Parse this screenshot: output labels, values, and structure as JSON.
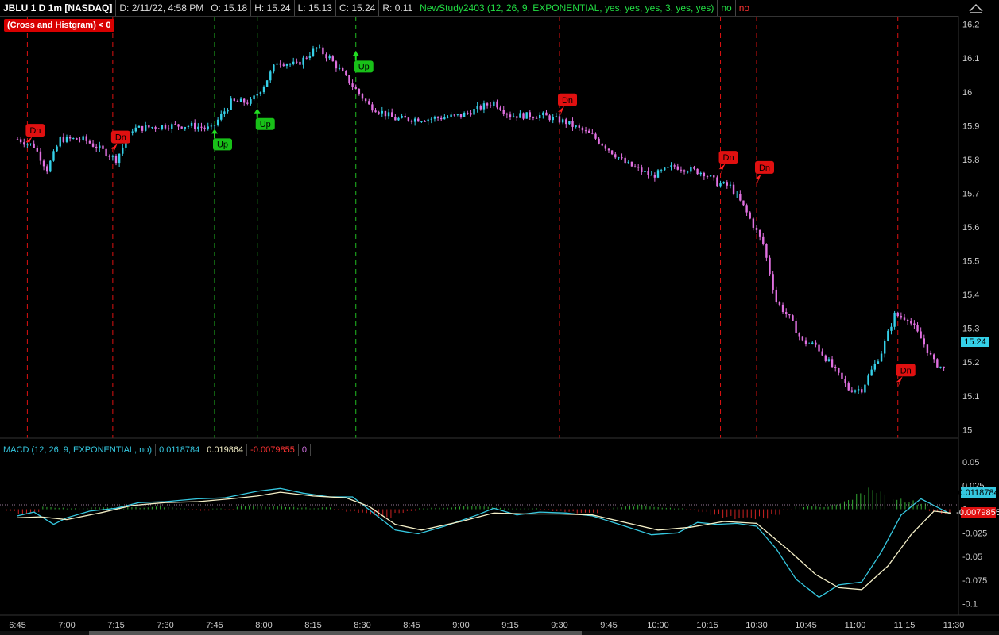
{
  "header": {
    "symbol": "JBLU 1 D 1m [NASDAQ]",
    "date": "D: 2/11/22, 4:58 PM",
    "open": "O: 15.18",
    "high": "H: 15.24",
    "low": "L: 15.13",
    "close": "C: 15.24",
    "range": "R: 0.11",
    "study": "NewStudy2403 (12, 26, 9, EXPONENTIAL, yes, yes, yes, 3, yes, yes)",
    "flag1": "no",
    "flag2": "no"
  },
  "alert_label": "(Cross and Histgram) < 0",
  "macd_header": {
    "label": "MACD (12, 26, 9, EXPONENTIAL, no)",
    "value": "0.0118784",
    "avg": "0.019864",
    "diff": "-0.0079855",
    "zero": "0"
  },
  "colors": {
    "up_candle": "#35d0e8",
    "down_candle": "#e070e0",
    "signal_up": "#22bb22",
    "signal_dn": "#dd1111",
    "macd_line": "#35c8e0",
    "avg_line": "#f5f0c8",
    "hist_pos": "#33aa33",
    "hist_neg": "#cc2222"
  },
  "chart_data": [
    {
      "type": "candlestick",
      "title": "JBLU 1 D 1m [NASDAQ]",
      "x_ticks": [
        "6:45",
        "7:00",
        "7:15",
        "7:30",
        "7:45",
        "8:00",
        "8:15",
        "8:30",
        "8:45",
        "9:00",
        "9:15",
        "9:30",
        "9:45",
        "10:00",
        "10:15",
        "10:30",
        "10:45",
        "11:00",
        "11:15",
        "11:30"
      ],
      "y_ticks": [
        "15",
        "15.1",
        "15.2",
        "15.3",
        "15.4",
        "15.5",
        "15.6",
        "15.7",
        "15.8",
        "15.9",
        "16",
        "16.1",
        "16.2"
      ],
      "ylim": [
        14.975,
        16.225
      ],
      "last_price": "15.24",
      "price_path": [
        [
          "6:45",
          15.86
        ],
        [
          "6:50",
          15.84
        ],
        [
          "6:54",
          15.77
        ],
        [
          "6:58",
          15.86
        ],
        [
          "7:05",
          15.86
        ],
        [
          "7:12",
          15.82
        ],
        [
          "7:15",
          15.8
        ],
        [
          "7:20",
          15.89
        ],
        [
          "7:30",
          15.9
        ],
        [
          "7:38",
          15.9
        ],
        [
          "7:44",
          15.89
        ],
        [
          "7:50",
          15.97
        ],
        [
          "7:56",
          15.97
        ],
        [
          "8:00",
          16.02
        ],
        [
          "8:04",
          16.09
        ],
        [
          "8:10",
          16.08
        ],
        [
          "8:16",
          16.13
        ],
        [
          "8:20",
          16.1
        ],
        [
          "8:26",
          16.03
        ],
        [
          "8:32",
          15.96
        ],
        [
          "8:40",
          15.92
        ],
        [
          "8:50",
          15.92
        ],
        [
          "9:00",
          15.93
        ],
        [
          "9:10",
          15.97
        ],
        [
          "9:15",
          15.93
        ],
        [
          "9:25",
          15.93
        ],
        [
          "9:32",
          15.91
        ],
        [
          "9:40",
          15.87
        ],
        [
          "9:50",
          15.79
        ],
        [
          "9:58",
          15.75
        ],
        [
          "10:05",
          15.78
        ],
        [
          "10:14",
          15.76
        ],
        [
          "10:18",
          15.73
        ],
        [
          "10:22",
          15.72
        ],
        [
          "10:26",
          15.66
        ],
        [
          "10:32",
          15.55
        ],
        [
          "10:36",
          15.38
        ],
        [
          "10:40",
          15.33
        ],
        [
          "10:44",
          15.26
        ],
        [
          "10:48",
          15.25
        ],
        [
          "10:52",
          15.2
        ],
        [
          "10:58",
          15.12
        ],
        [
          "11:02",
          15.12
        ],
        [
          "11:08",
          15.23
        ],
        [
          "11:12",
          15.34
        ],
        [
          "11:16",
          15.33
        ],
        [
          "11:20",
          15.27
        ],
        [
          "11:24",
          15.2
        ],
        [
          "11:27",
          15.18
        ]
      ],
      "signals": [
        {
          "time": "6:48",
          "label": "Dn",
          "kind": "dn",
          "price": 15.83
        },
        {
          "time": "7:14",
          "label": "Dn",
          "kind": "dn",
          "price": 15.81
        },
        {
          "time": "7:45",
          "label": "Up",
          "kind": "up",
          "price": 15.9
        },
        {
          "time": "7:58",
          "label": "Up",
          "kind": "up",
          "price": 15.96
        },
        {
          "time": "8:28",
          "label": "Up",
          "kind": "up",
          "price": 16.13
        },
        {
          "time": "9:30",
          "label": "Dn",
          "kind": "dn",
          "price": 15.92
        },
        {
          "time": "10:19",
          "label": "Dn",
          "kind": "dn",
          "price": 15.75
        },
        {
          "time": "10:30",
          "label": "Dn",
          "kind": "dn",
          "price": 15.72
        },
        {
          "time": "11:13",
          "label": "Dn",
          "kind": "dn",
          "price": 15.12
        }
      ]
    },
    {
      "type": "line",
      "title": "MACD (12, 26, 9, EXPONENTIAL, no)",
      "y_ticks": [
        "0.05",
        "0.025",
        "0",
        "-0.025",
        "-0.05",
        "-0.075",
        "-0.1"
      ],
      "ylim": [
        -0.112,
        0.055
      ],
      "series": [
        {
          "name": "Value",
          "points": [
            [
              "6:45",
              -0.007
            ],
            [
              "6:50",
              -0.003
            ],
            [
              "6:56",
              -0.016
            ],
            [
              "7:00",
              -0.009
            ],
            [
              "7:07",
              -0.002
            ],
            [
              "7:15",
              0.001
            ],
            [
              "7:22",
              0.007
            ],
            [
              "7:30",
              0.008
            ],
            [
              "7:40",
              0.011
            ],
            [
              "7:48",
              0.012
            ],
            [
              "7:58",
              0.019
            ],
            [
              "8:05",
              0.022
            ],
            [
              "8:12",
              0.017
            ],
            [
              "8:20",
              0.013
            ],
            [
              "8:27",
              0.013
            ],
            [
              "8:33",
              -0.003
            ],
            [
              "8:40",
              -0.022
            ],
            [
              "8:47",
              -0.026
            ],
            [
              "8:55",
              -0.018
            ],
            [
              "9:05",
              -0.006
            ],
            [
              "9:10",
              0.001
            ],
            [
              "9:17",
              -0.006
            ],
            [
              "9:24",
              -0.003
            ],
            [
              "9:32",
              -0.004
            ],
            [
              "9:40",
              -0.007
            ],
            [
              "9:50",
              -0.018
            ],
            [
              "9:58",
              -0.027
            ],
            [
              "10:06",
              -0.025
            ],
            [
              "10:12",
              -0.014
            ],
            [
              "10:18",
              -0.016
            ],
            [
              "10:24",
              -0.015
            ],
            [
              "10:30",
              -0.018
            ],
            [
              "10:36",
              -0.042
            ],
            [
              "10:42",
              -0.074
            ],
            [
              "10:49",
              -0.093
            ],
            [
              "10:55",
              -0.08
            ],
            [
              "11:02",
              -0.077
            ],
            [
              "11:08",
              -0.045
            ],
            [
              "11:14",
              -0.006
            ],
            [
              "11:20",
              0.011
            ],
            [
              "11:24",
              0.004
            ],
            [
              "11:29",
              -0.005
            ]
          ]
        },
        {
          "name": "Avg",
          "points": [
            [
              "6:45",
              -0.009
            ],
            [
              "6:52",
              -0.008
            ],
            [
              "7:00",
              -0.011
            ],
            [
              "7:10",
              -0.004
            ],
            [
              "7:20",
              0.004
            ],
            [
              "7:30",
              0.007
            ],
            [
              "7:40",
              0.008
            ],
            [
              "7:50",
              0.011
            ],
            [
              "7:58",
              0.014
            ],
            [
              "8:05",
              0.018
            ],
            [
              "8:15",
              0.014
            ],
            [
              "8:25",
              0.012
            ],
            [
              "8:32",
              0.003
            ],
            [
              "8:40",
              -0.016
            ],
            [
              "8:48",
              -0.022
            ],
            [
              "9:00",
              -0.013
            ],
            [
              "9:10",
              -0.004
            ],
            [
              "9:20",
              -0.005
            ],
            [
              "9:30",
              -0.005
            ],
            [
              "9:40",
              -0.006
            ],
            [
              "9:50",
              -0.014
            ],
            [
              "10:00",
              -0.022
            ],
            [
              "10:10",
              -0.019
            ],
            [
              "10:20",
              -0.013
            ],
            [
              "10:30",
              -0.015
            ],
            [
              "10:40",
              -0.044
            ],
            [
              "10:48",
              -0.069
            ],
            [
              "10:55",
              -0.083
            ],
            [
              "11:02",
              -0.085
            ],
            [
              "11:10",
              -0.06
            ],
            [
              "11:17",
              -0.027
            ],
            [
              "11:24",
              -0.002
            ],
            [
              "11:29",
              -0.004
            ]
          ]
        }
      ],
      "histogram": [
        [
          -0.002,
          -0.005,
          -0.004,
          0.003,
          0.002,
          0.001,
          0.001,
          0.002,
          0.002,
          0.001,
          0.003,
          0.002,
          0.003,
          0.002,
          0.001,
          -0.001,
          -0.002,
          0.001,
          -0.001,
          0.003,
          0.004,
          0.003,
          0.004,
          0.003,
          0.002,
          0.001,
          0.002,
          -0.001,
          -0.003,
          -0.005,
          -0.008,
          -0.009,
          -0.004,
          -0.002,
          0.001,
          0.002,
          0.002,
          0.003,
          0.003,
          0.003,
          0.002,
          0.001,
          0.001,
          0.001,
          -0.001,
          -0.002,
          -0.003,
          -0.005,
          -0.005,
          -0.001,
          0.002,
          0.003,
          0.005,
          0.003,
          0.002,
          0.001,
          -0.001,
          -0.003,
          -0.006,
          -0.01,
          -0.013,
          -0.012,
          -0.01,
          -0.006,
          -0.001,
          0.003,
          0.004,
          0.003,
          0.006,
          0.01,
          0.017,
          0.023,
          0.021,
          0.014,
          0.01,
          0.006,
          -0.002,
          -0.005
        ]
      ]
    }
  ]
}
